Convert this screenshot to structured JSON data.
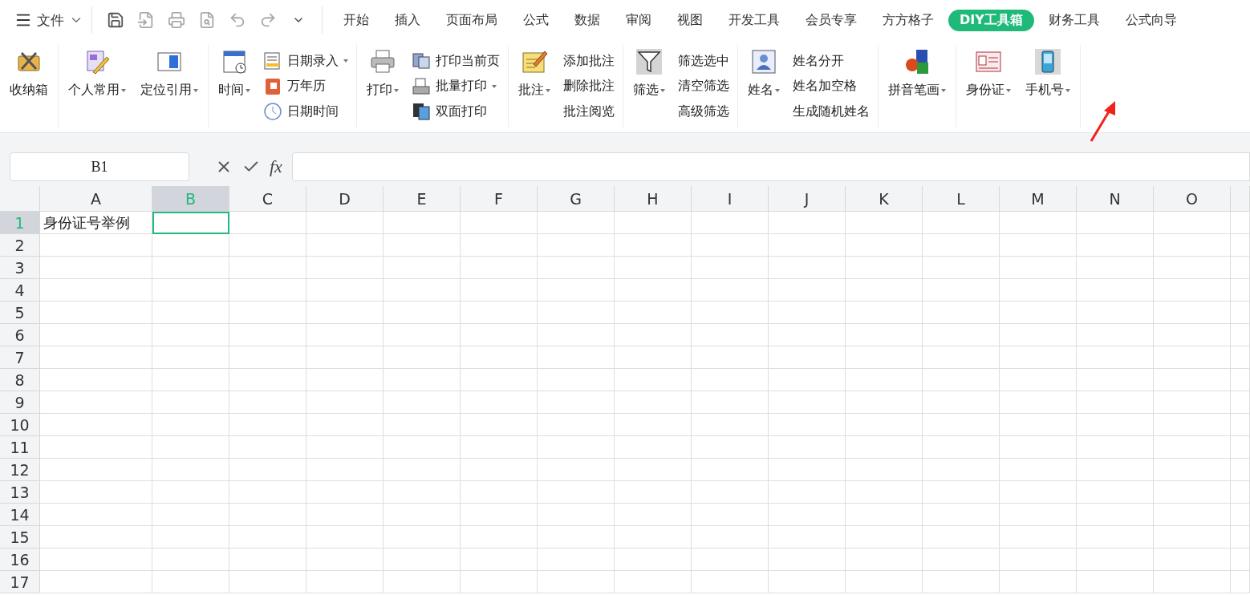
{
  "menu": {
    "label": "文件"
  },
  "tabs": [
    {
      "label": "开始",
      "selected": false
    },
    {
      "label": "插入",
      "selected": false
    },
    {
      "label": "页面布局",
      "selected": false
    },
    {
      "label": "公式",
      "selected": false
    },
    {
      "label": "数据",
      "selected": false
    },
    {
      "label": "审阅",
      "selected": false
    },
    {
      "label": "视图",
      "selected": false
    },
    {
      "label": "开发工具",
      "selected": false
    },
    {
      "label": "会员专享",
      "selected": false
    },
    {
      "label": "方方格子",
      "selected": false
    },
    {
      "label": "DIY工具箱",
      "selected": true
    },
    {
      "label": "财务工具",
      "selected": false
    },
    {
      "label": "公式向导",
      "selected": false
    }
  ],
  "ribbon": {
    "groups": [
      {
        "columns": [
          {
            "kind": "large",
            "label": "收纳箱",
            "dropdown": false
          }
        ]
      },
      {
        "columns": [
          {
            "kind": "large",
            "label": "个人常用",
            "dropdown": true
          },
          {
            "kind": "large",
            "label": "定位引用",
            "dropdown": true
          }
        ]
      },
      {
        "columns": [
          {
            "kind": "large",
            "label": "时间",
            "dropdown": true
          },
          {
            "kind": "stack",
            "items": [
              {
                "label": "日期录入",
                "dropdown": true,
                "icon": true
              },
              {
                "label": "万年历",
                "dropdown": false,
                "icon": true
              },
              {
                "label": "日期时间",
                "dropdown": false,
                "icon": true
              }
            ]
          }
        ]
      },
      {
        "columns": [
          {
            "kind": "large",
            "label": "打印",
            "dropdown": true
          },
          {
            "kind": "stack",
            "items": [
              {
                "label": "打印当前页",
                "dropdown": false,
                "icon": true
              },
              {
                "label": "批量打印",
                "dropdown": true,
                "icon": true
              },
              {
                "label": "双面打印",
                "dropdown": false,
                "icon": true
              }
            ]
          }
        ]
      },
      {
        "columns": [
          {
            "kind": "large",
            "label": "批注",
            "dropdown": true
          },
          {
            "kind": "stack",
            "items": [
              {
                "label": "添加批注",
                "dropdown": false,
                "icon": false
              },
              {
                "label": "删除批注",
                "dropdown": false,
                "icon": false
              },
              {
                "label": "批注阅览",
                "dropdown": false,
                "icon": false
              }
            ]
          }
        ]
      },
      {
        "columns": [
          {
            "kind": "large",
            "label": "筛选",
            "dropdown": true
          },
          {
            "kind": "stack",
            "items": [
              {
                "label": "筛选选中",
                "dropdown": false,
                "icon": false
              },
              {
                "label": "清空筛选",
                "dropdown": false,
                "icon": false
              },
              {
                "label": "高级筛选",
                "dropdown": false,
                "icon": false
              }
            ]
          }
        ]
      },
      {
        "columns": [
          {
            "kind": "large",
            "label": "姓名",
            "dropdown": true
          },
          {
            "kind": "stack",
            "items": [
              {
                "label": "姓名分开",
                "dropdown": false,
                "icon": false
              },
              {
                "label": "姓名加空格",
                "dropdown": false,
                "icon": false
              },
              {
                "label": "生成随机姓名",
                "dropdown": false,
                "icon": false
              }
            ]
          }
        ]
      },
      {
        "columns": [
          {
            "kind": "large",
            "label": "拼音笔画",
            "dropdown": true
          }
        ]
      },
      {
        "columns": [
          {
            "kind": "large",
            "label": "身份证",
            "dropdown": true
          },
          {
            "kind": "large",
            "label": "手机号",
            "dropdown": true
          }
        ]
      }
    ]
  },
  "formula_bar": {
    "name_box": "B1",
    "fx": "fx"
  },
  "sheet": {
    "columns": [
      {
        "label": "A",
        "selected": false
      },
      {
        "label": "B",
        "selected": true
      },
      {
        "label": "C",
        "selected": false
      },
      {
        "label": "D",
        "selected": false
      },
      {
        "label": "E",
        "selected": false
      },
      {
        "label": "F",
        "selected": false
      },
      {
        "label": "G",
        "selected": false
      },
      {
        "label": "H",
        "selected": false
      },
      {
        "label": "I",
        "selected": false
      },
      {
        "label": "J",
        "selected": false
      },
      {
        "label": "K",
        "selected": false
      },
      {
        "label": "L",
        "selected": false
      },
      {
        "label": "M",
        "selected": false
      },
      {
        "label": "N",
        "selected": false
      },
      {
        "label": "O",
        "selected": false
      }
    ],
    "rows": [
      {
        "label": "1",
        "selected": true,
        "cells": [
          "身份证号举例"
        ]
      },
      {
        "label": "2",
        "selected": false
      },
      {
        "label": "3",
        "selected": false
      },
      {
        "label": "4",
        "selected": false
      },
      {
        "label": "5",
        "selected": false
      },
      {
        "label": "6",
        "selected": false
      },
      {
        "label": "7",
        "selected": false
      },
      {
        "label": "8",
        "selected": false
      },
      {
        "label": "9",
        "selected": false
      },
      {
        "label": "10",
        "selected": false
      },
      {
        "label": "11",
        "selected": false
      },
      {
        "label": "12",
        "selected": false
      },
      {
        "label": "13",
        "selected": false
      },
      {
        "label": "14",
        "selected": false
      },
      {
        "label": "15",
        "selected": false
      },
      {
        "label": "16",
        "selected": false
      },
      {
        "label": "17",
        "selected": false
      }
    ]
  }
}
